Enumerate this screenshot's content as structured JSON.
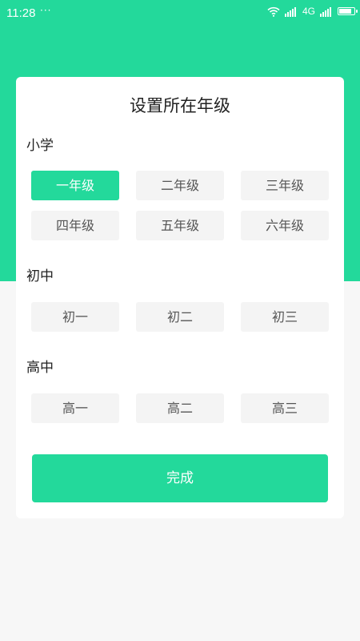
{
  "status_bar": {
    "time": "11:28",
    "dots": "···",
    "network": "4G",
    "battery_level": 0.85
  },
  "dialog": {
    "title": "设置所在年级",
    "sections": [
      {
        "label": "小学",
        "grades": [
          "一年级",
          "二年级",
          "三年级",
          "四年级",
          "五年级",
          "六年级"
        ]
      },
      {
        "label": "初中",
        "grades": [
          "初一",
          "初二",
          "初三"
        ]
      },
      {
        "label": "高中",
        "grades": [
          "高一",
          "高二",
          "高三"
        ]
      }
    ],
    "selected_grade": "一年级",
    "done_label": "完成"
  },
  "colors": {
    "accent": "#23d99b",
    "unselected_bg": "#f4f4f4",
    "page_bg": "#f7f7f7"
  }
}
